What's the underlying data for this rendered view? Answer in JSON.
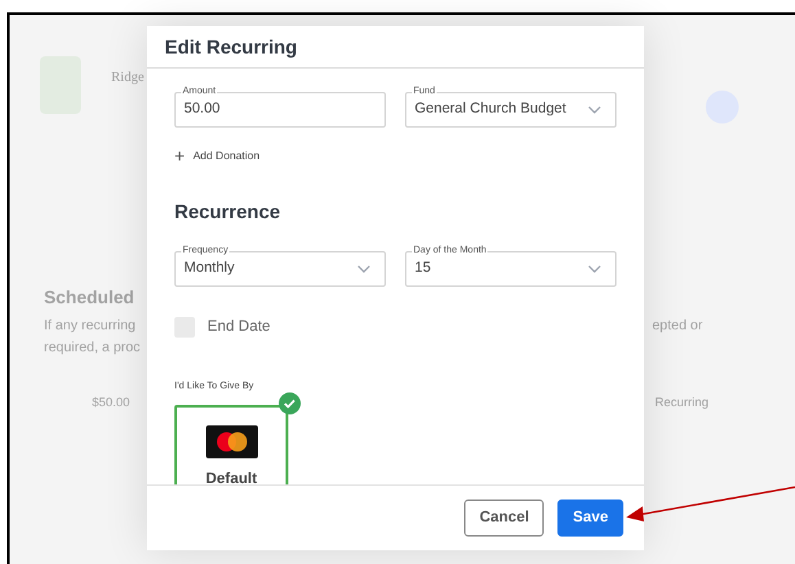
{
  "background": {
    "org_name": "Ridge",
    "heading": "Scheduled",
    "text_lines": [
      "If any recurring",
      "required, a proc"
    ],
    "text_right": "epted or",
    "row_amount": "$50.00",
    "row_status": "Recurring"
  },
  "dialog": {
    "title": "Edit Recurring",
    "donation": {
      "amount": {
        "label": "Amount",
        "value": "50.00"
      },
      "fund": {
        "label": "Fund",
        "value": "General Church Budget"
      },
      "add_icon": "+",
      "add_label": "Add Donation"
    },
    "recurrence": {
      "heading": "Recurrence",
      "frequency": {
        "label": "Frequency",
        "value": "Monthly"
      },
      "day": {
        "label": "Day of the Month",
        "value": "15"
      },
      "end_date": {
        "label": "End Date",
        "checked": false
      }
    },
    "payment": {
      "label": "I'd Like To Give By",
      "methods": [
        {
          "name": "Default",
          "selected": true
        }
      ]
    },
    "buttons": [
      {
        "label": "Cancel",
        "kind": "secondary"
      },
      {
        "label": "Save",
        "kind": "primary"
      }
    ]
  }
}
